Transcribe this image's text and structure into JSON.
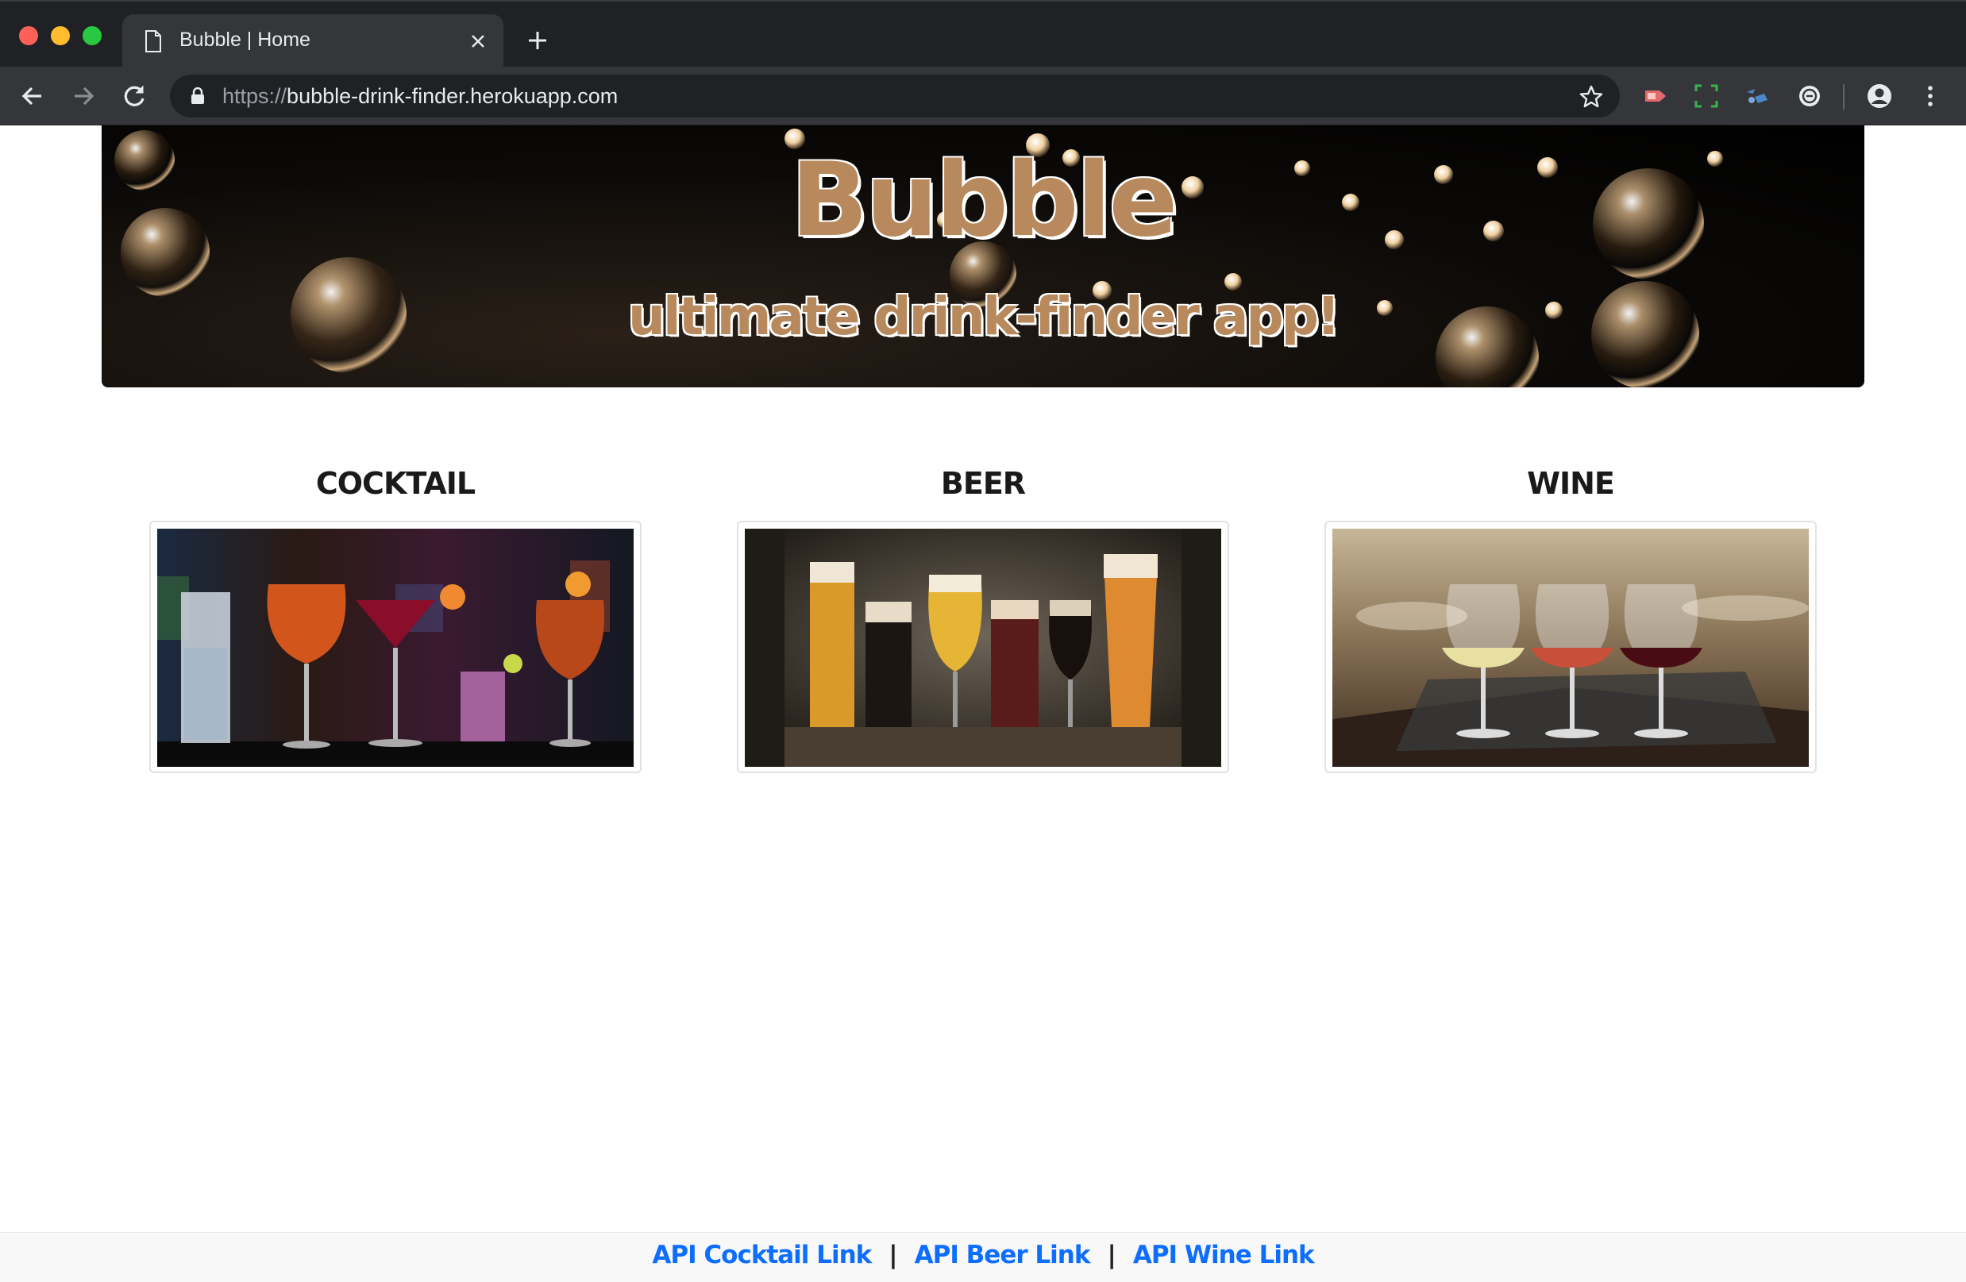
{
  "browser": {
    "tab_title": "Bubble | Home",
    "url_scheme": "https://",
    "url_host": "bubble-drink-finder.herokuapp.com"
  },
  "hero": {
    "title": "Bubble",
    "subtitle": "ultimate drink-finder app!"
  },
  "categories": [
    {
      "label": "COCKTAIL",
      "image": "cocktails-photo"
    },
    {
      "label": "BEER",
      "image": "beers-photo"
    },
    {
      "label": "WINE",
      "image": "wine-glasses-photo"
    }
  ],
  "footer": {
    "links": [
      "API Cocktail Link",
      "API Beer Link",
      "API Wine Link"
    ],
    "separator": "|"
  },
  "colors": {
    "brand": "#b7895c",
    "link": "#0d6efd"
  },
  "icons": [
    "document-icon",
    "close-icon",
    "plus-icon",
    "back-icon",
    "forward-icon",
    "reload-icon",
    "lock-icon",
    "star-icon",
    "profile-icon",
    "menu-icon"
  ]
}
